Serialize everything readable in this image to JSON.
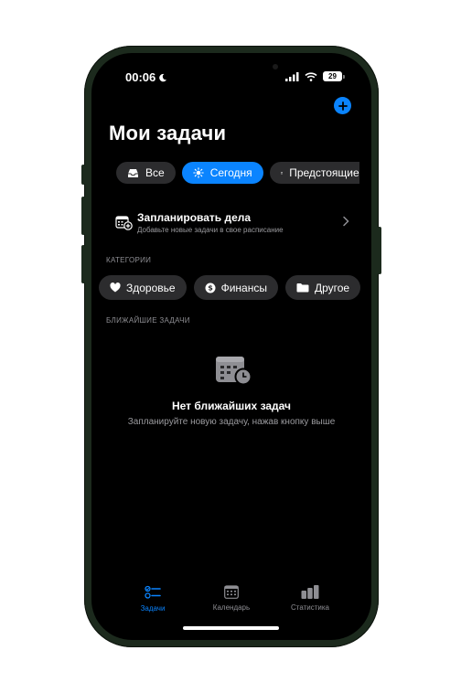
{
  "status_bar": {
    "time": "00:06",
    "battery": "29"
  },
  "header": {
    "title": "Мои задачи"
  },
  "filters": [
    {
      "label": "Все",
      "icon": "tray-icon"
    },
    {
      "label": "Сегодня",
      "icon": "sun-icon",
      "active": true
    },
    {
      "label": "Предстоящие",
      "icon": "calendar-icon"
    }
  ],
  "schedule": {
    "title": "Запланировать дела",
    "subtitle": "Добавьте новые задачи в свое расписание"
  },
  "categories": {
    "label": "КАТЕГОРИИ",
    "items": [
      {
        "label": "Здоровье",
        "icon": "heart-icon"
      },
      {
        "label": "Финансы",
        "icon": "dollar-icon"
      },
      {
        "label": "Другое",
        "icon": "folder-icon"
      }
    ]
  },
  "upcoming": {
    "label": "БЛИЖАЙШИЕ ЗАДАЧИ",
    "empty_title": "Нет ближайших задач",
    "empty_subtitle": "Запланируйте новую задачу, нажав кнопку выше"
  },
  "tabbar": [
    {
      "label": "Задачи",
      "icon": "checklist-icon",
      "active": true
    },
    {
      "label": "Календарь",
      "icon": "calendar-icon"
    },
    {
      "label": "Статистика",
      "icon": "chart-icon"
    }
  ],
  "colors": {
    "accent": "#0a84ff",
    "chip_bg": "#2c2c2e",
    "secondary_text": "#8e8e93"
  }
}
